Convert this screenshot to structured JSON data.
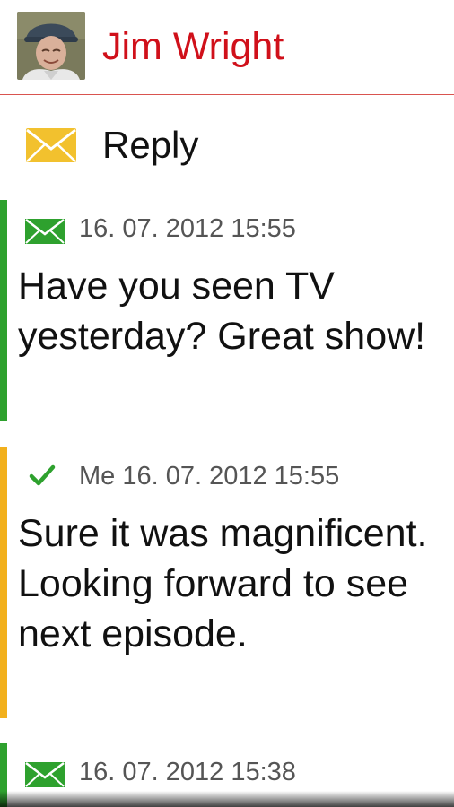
{
  "header": {
    "contact_name": "Jim Wright",
    "avatar_icon": "person-photo-avatar"
  },
  "reply": {
    "label": "Reply",
    "icon": "envelope-icon"
  },
  "colors": {
    "accent_red": "#d0101a",
    "incoming_bar": "#2ea12e",
    "outgoing_bar": "#f2b01c",
    "envelope_green": "#2ea12e",
    "envelope_yellow": "#f2c12e"
  },
  "messages": [
    {
      "direction": "incoming",
      "icon": "envelope-icon",
      "meta": "16. 07. 2012 15:55",
      "body": "Have you seen TV yesterday? Great show!"
    },
    {
      "direction": "outgoing",
      "icon": "check-icon",
      "meta": "Me 16. 07. 2012 15:55",
      "body": "Sure it was magnificent. Looking forward to see next episode."
    },
    {
      "direction": "incoming",
      "icon": "envelope-icon",
      "meta": "16. 07. 2012 15:38",
      "body": ""
    }
  ]
}
